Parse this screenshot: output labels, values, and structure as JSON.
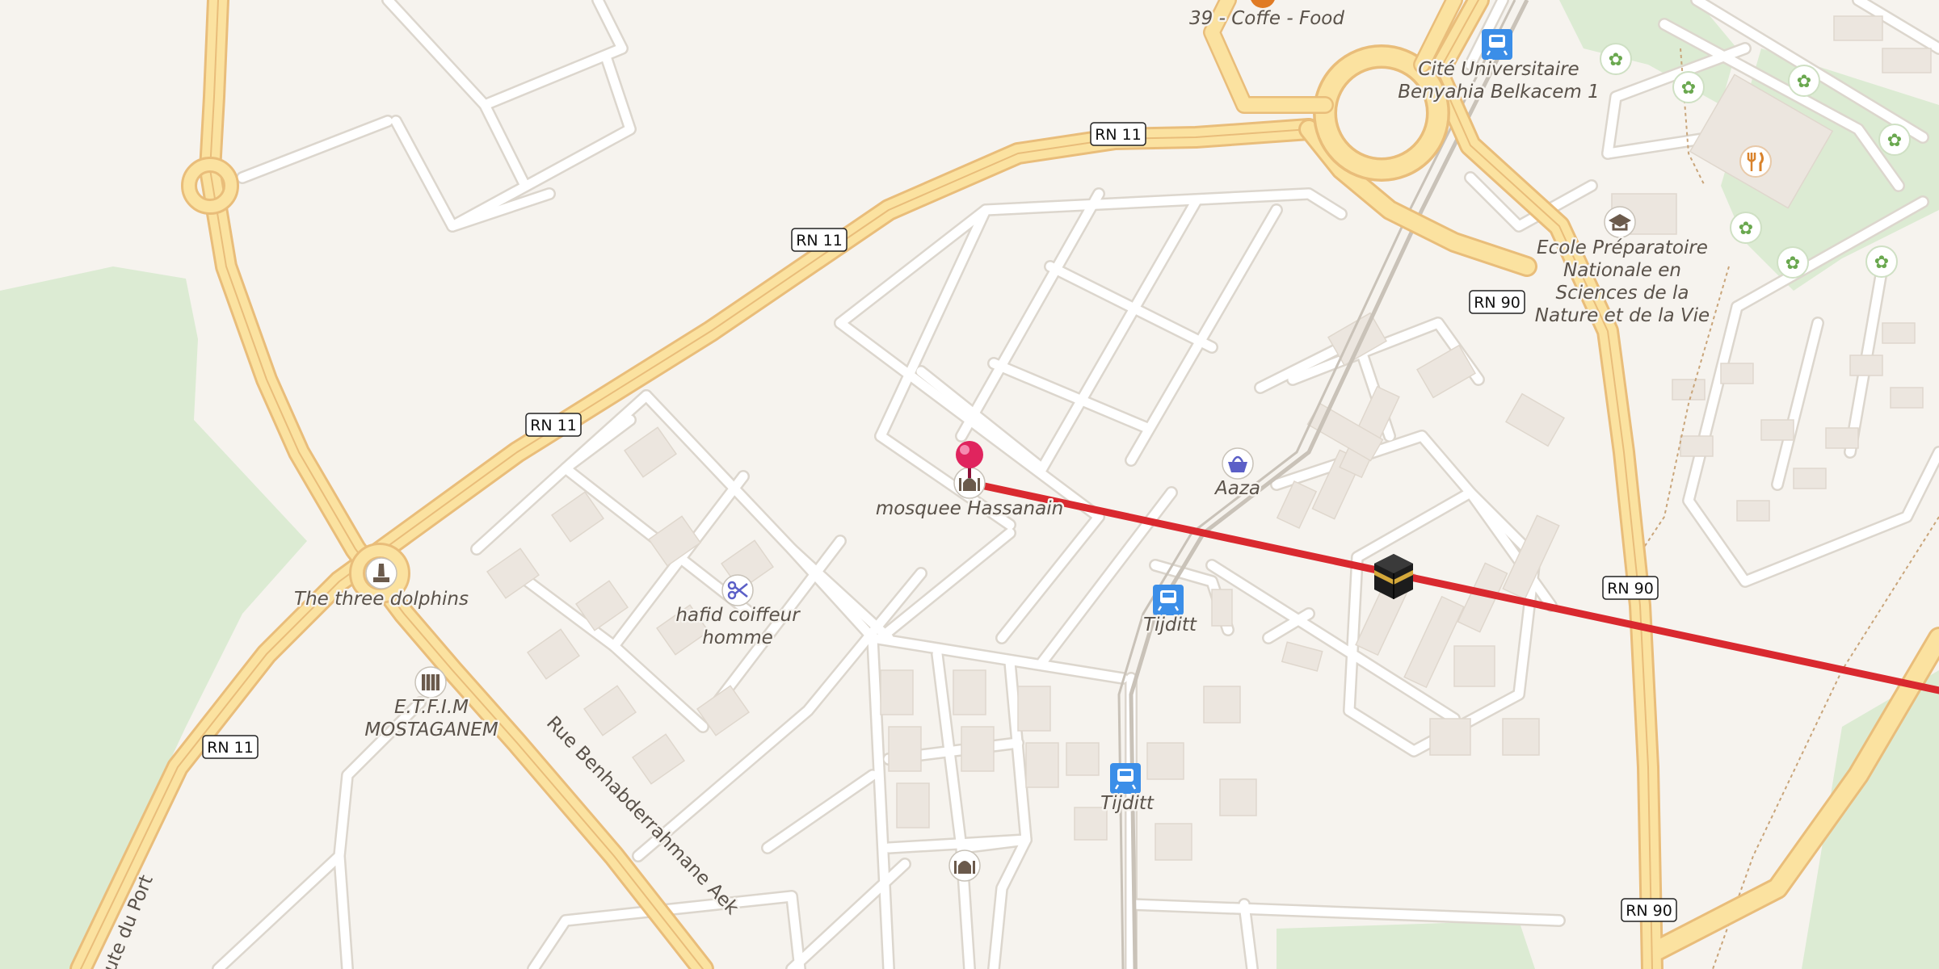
{
  "map": {
    "road_refs": {
      "rn11": "RN 11",
      "rn90": "RN 90"
    },
    "street_names": {
      "benhabderrahmane": "Rue Benhabderrahmane Aek",
      "route_port": "Route du Port"
    },
    "pois": [
      {
        "id": "coffee",
        "label": "39 - Coffe - Food",
        "icon": "cafe-icon"
      },
      {
        "id": "cite",
        "label_lines": [
          "Cité Universitaire",
          "Benyahia Belkacem 1"
        ],
        "icon": "train-station-icon"
      },
      {
        "id": "ecole",
        "label_lines": [
          "Ecole Préparatoire",
          "Nationale en",
          "Sciences de la",
          "Nature et de la Vie"
        ],
        "icon": "graduation-cap-icon"
      },
      {
        "id": "mosque",
        "label": "mosquee Hassanain",
        "icon": "mosque-icon"
      },
      {
        "id": "aaza",
        "label": "Aaza",
        "icon": "shopping-basket-icon"
      },
      {
        "id": "tijditt1",
        "label": "Tijditt",
        "icon": "train-station-icon"
      },
      {
        "id": "tijditt2",
        "label": "Tijditt",
        "icon": "train-station-icon"
      },
      {
        "id": "coiffeur",
        "label_lines": [
          "hafid coiffeur",
          "homme"
        ],
        "icon": "scissors-icon"
      },
      {
        "id": "dolphins",
        "label": "The three dolphins",
        "icon": "monument-icon"
      },
      {
        "id": "etfim",
        "label_lines": [
          "E.T.F.I.M",
          "MOSTAGANEM"
        ],
        "icon": "school-icon"
      },
      {
        "id": "mosque2",
        "label": "",
        "icon": "mosque-icon"
      },
      {
        "id": "restaurant",
        "label": "",
        "icon": "fork-knife-icon"
      }
    ],
    "colors": {
      "background": "#f6f3ee",
      "major_road_fill": "#fbe2a0",
      "major_road_casing": "#e9bd7a",
      "minor_road": "#ffffff",
      "minor_road_casing": "#dcd6cd",
      "building": "#ece6df",
      "park": "#dcebd3",
      "route_line": "#d9292f",
      "marker": "#e0245e",
      "transit": "#3b8ee8",
      "garden_icon": "#6aa84f"
    }
  }
}
